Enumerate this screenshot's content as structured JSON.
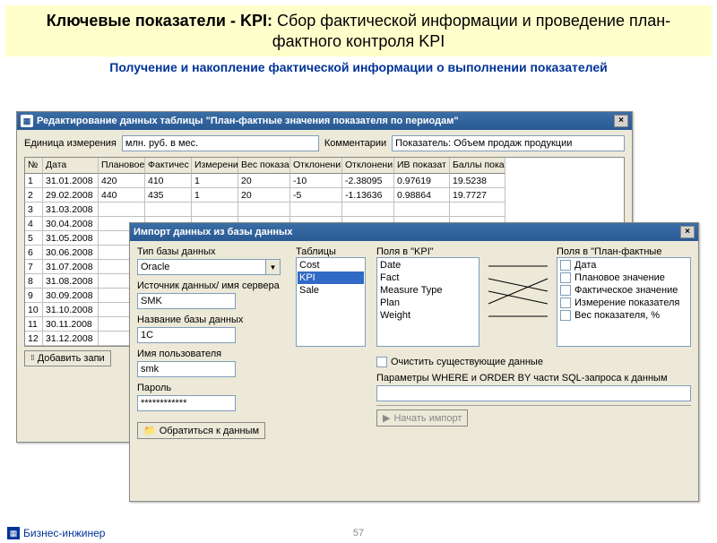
{
  "slide": {
    "title_bold": "Ключевые показатели - KPI:",
    "title_rest": " Сбор фактической информации и проведение план-фактного контроля KPI",
    "subtitle": "Получение и накопление фактической информации о выполнении показателей",
    "page_number": "57",
    "brand": "Бизнес-инжинер"
  },
  "win1": {
    "title": "Редактирование данных таблицы  \"План-фактные значения показателя по периодам\"",
    "unit_label": "Единица измерения",
    "unit_value": "млн. руб. в мес.",
    "comment_label": "Комментарии",
    "comment_value": "Показатель: Объем продаж продукции",
    "add_button": "Добавить запи",
    "columns": [
      "№",
      "Дата",
      "Плановое",
      "Фактичес",
      "Измерени",
      "Вес показа",
      "Отклонени",
      "Отклонени",
      "ИВ показат",
      "Баллы пока"
    ],
    "rows": [
      [
        "1",
        "31.01.2008",
        "420",
        "410",
        "1",
        "20",
        "-10",
        "-2.38095",
        "0.97619",
        "19.5238"
      ],
      [
        "2",
        "29.02.2008",
        "440",
        "435",
        "1",
        "20",
        "-5",
        "-1.13636",
        "0.98864",
        "19.7727"
      ],
      [
        "3",
        "31.03.2008",
        "",
        "",
        "",
        "",
        "",
        "",
        "",
        ""
      ],
      [
        "4",
        "30.04.2008",
        "",
        "",
        "",
        "",
        "",
        "",
        "",
        ""
      ],
      [
        "5",
        "31.05.2008",
        "",
        "",
        "",
        "",
        "",
        "",
        "",
        ""
      ],
      [
        "6",
        "30.06.2008",
        "",
        "",
        "",
        "",
        "",
        "",
        "",
        ""
      ],
      [
        "7",
        "31.07.2008",
        "",
        "",
        "",
        "",
        "",
        "",
        "",
        ""
      ],
      [
        "8",
        "31.08.2008",
        "",
        "",
        "",
        "",
        "",
        "",
        "",
        ""
      ],
      [
        "9",
        "30.09.2008",
        "",
        "",
        "",
        "",
        "",
        "",
        "",
        ""
      ],
      [
        "10",
        "31.10.2008",
        "",
        "",
        "",
        "",
        "",
        "",
        "",
        ""
      ],
      [
        "11",
        "30.11.2008",
        "",
        "",
        "",
        "",
        "",
        "",
        "",
        ""
      ],
      [
        "12",
        "31.12.2008",
        "",
        "",
        "",
        "",
        "",
        "",
        "",
        ""
      ]
    ]
  },
  "win2": {
    "title": "Импорт данных из базы данных",
    "db_type_label": "Тип базы данных",
    "db_type_value": "Oracle",
    "datasource_label": "Источник данных/ имя сервера",
    "datasource_value": "SMK",
    "dbname_label": "Название базы данных",
    "dbname_value": "1С",
    "username_label": "Имя пользователя",
    "username_value": "smk",
    "password_label": "Пароль",
    "password_value": "************",
    "tables_label": "Таблицы",
    "tables_items": [
      "Cost",
      "KPI",
      "Sale"
    ],
    "tables_selected": "KPI",
    "fields_kpi_label": "Поля в \"KPI\"",
    "fields_kpi": [
      "Date",
      "Fact",
      "Measure Type",
      "Plan",
      "Weight"
    ],
    "fields_target_label": "Поля в  \"План-фактные",
    "fields_target": [
      "Дата",
      "Плановое значение",
      "Фактическое значение",
      "Измерение показателя",
      "Вес показателя, %"
    ],
    "clear_checkbox": "Очистить существующие данные",
    "where_label": "Параметры WHERE и ORDER BY части SQL-запроса к данным",
    "connect_btn": "Обратиться к данным",
    "import_btn": "Начать импорт"
  }
}
